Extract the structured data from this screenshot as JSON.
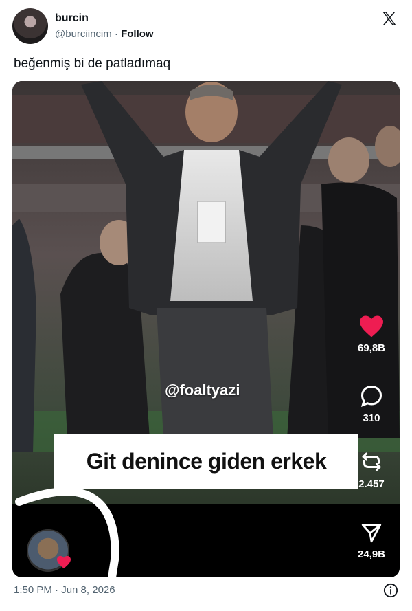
{
  "author": {
    "name": "burcin",
    "handle": "@burciincim",
    "separator": "·",
    "follow_label": "Follow"
  },
  "tweet": {
    "text": "beğenmiş bi de patladımaq",
    "timestamp": "1:50 PM · Jun 8, 2026"
  },
  "video": {
    "watermark": "@foaltyazi",
    "caption": "Git denince giden erkek",
    "actions": {
      "likes": "69,8B",
      "comments": "310",
      "reposts": "2.457",
      "shares": "24,9B"
    }
  },
  "colors": {
    "like_heart": "#ee1d52",
    "text_secondary": "#536471",
    "text_primary": "#0f1419"
  },
  "icons": [
    "x-logo-icon",
    "heart-icon",
    "comment-icon",
    "repost-icon",
    "share-icon",
    "info-icon"
  ]
}
